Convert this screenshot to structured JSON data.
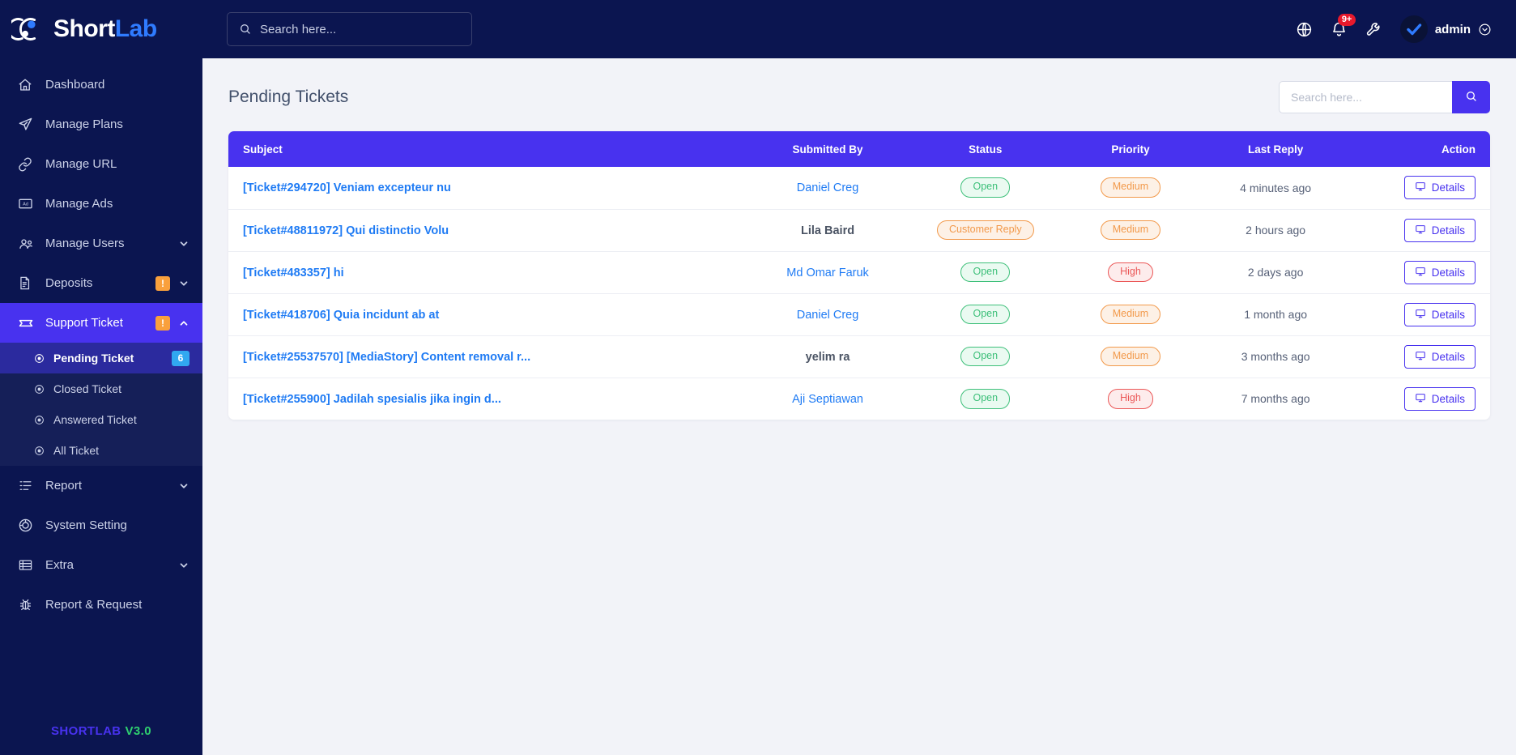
{
  "brand": {
    "name_part1": "Short",
    "name_part2": "Lab"
  },
  "topbar": {
    "search_placeholder": "Search here...",
    "notification_count": "9+",
    "username": "admin"
  },
  "sidebar": {
    "items": [
      {
        "label": "Dashboard",
        "icon": "home-icon",
        "has_caret": false,
        "warn": false
      },
      {
        "label": "Manage Plans",
        "icon": "paper-plane-icon",
        "has_caret": false,
        "warn": false
      },
      {
        "label": "Manage URL",
        "icon": "link-icon",
        "has_caret": false,
        "warn": false
      },
      {
        "label": "Manage Ads",
        "icon": "ad-icon",
        "has_caret": false,
        "warn": false
      },
      {
        "label": "Manage Users",
        "icon": "users-icon",
        "has_caret": true,
        "warn": false
      },
      {
        "label": "Deposits",
        "icon": "invoice-icon",
        "has_caret": true,
        "warn": true
      },
      {
        "label": "Support Ticket",
        "icon": "ticket-icon",
        "has_caret": true,
        "warn": true,
        "active": true
      }
    ],
    "support_sub_items": [
      {
        "label": "Pending Ticket",
        "badge": "6",
        "active": true
      },
      {
        "label": "Closed Ticket",
        "badge": "",
        "active": false
      },
      {
        "label": "Answered Ticket",
        "badge": "",
        "active": false
      },
      {
        "label": "All Ticket",
        "badge": "",
        "active": false
      }
    ],
    "items_bottom": [
      {
        "label": "Report",
        "icon": "list-icon",
        "has_caret": true,
        "warn": false
      },
      {
        "label": "System Setting",
        "icon": "settings-icon",
        "has_caret": false,
        "warn": false
      },
      {
        "label": "Extra",
        "icon": "grid-icon",
        "has_caret": true,
        "warn": false
      },
      {
        "label": "Report & Request",
        "icon": "bug-icon",
        "has_caret": false,
        "warn": false
      }
    ],
    "footer": {
      "name": "SHORTLAB",
      "version": "V3.0"
    }
  },
  "main": {
    "page_title": "Pending Tickets",
    "search_placeholder": "Search here...",
    "search_value": "",
    "table": {
      "columns": [
        "Subject",
        "Submitted By",
        "Status",
        "Priority",
        "Last Reply",
        "Action"
      ],
      "action_label": "Details",
      "rows": [
        {
          "subject": "[Ticket#294720] Veniam excepteur nu",
          "submitted_by": "Daniel Creg",
          "submitted_by_is_link": true,
          "status": "Open",
          "status_kind": "open",
          "priority": "Medium",
          "priority_kind": "medium",
          "last_reply": "4 minutes ago"
        },
        {
          "subject": "[Ticket#48811972] Qui distinctio Volu",
          "submitted_by": "Lila Baird",
          "submitted_by_is_link": false,
          "status": "Customer Reply",
          "status_kind": "reply",
          "priority": "Medium",
          "priority_kind": "medium",
          "last_reply": "2 hours ago"
        },
        {
          "subject": "[Ticket#483357] hi",
          "submitted_by": "Md Omar Faruk",
          "submitted_by_is_link": true,
          "status": "Open",
          "status_kind": "open",
          "priority": "High",
          "priority_kind": "high",
          "last_reply": "2 days ago"
        },
        {
          "subject": "[Ticket#418706] Quia incidunt ab at",
          "submitted_by": "Daniel Creg",
          "submitted_by_is_link": true,
          "status": "Open",
          "status_kind": "open",
          "priority": "Medium",
          "priority_kind": "medium",
          "last_reply": "1 month ago"
        },
        {
          "subject": "[Ticket#25537570] [MediaStory] Content removal r...",
          "submitted_by": "yelim ra",
          "submitted_by_is_link": false,
          "status": "Open",
          "status_kind": "open",
          "priority": "Medium",
          "priority_kind": "medium",
          "last_reply": "3 months ago"
        },
        {
          "subject": "[Ticket#255900] Jadilah spesialis jika ingin d...",
          "submitted_by": "Aji Septiawan",
          "submitted_by_is_link": true,
          "status": "Open",
          "status_kind": "open",
          "priority": "High",
          "priority_kind": "high",
          "last_reply": "7 months ago"
        }
      ]
    }
  },
  "colors": {
    "sidebar_bg": "#0b1550",
    "accent": "#4832ef",
    "link": "#1f7bf4",
    "open": "#3ec07a",
    "medium": "#f2994a",
    "high": "#eb5757",
    "warn_badge": "#f9a03c",
    "count_badge": "#31a8f0"
  }
}
